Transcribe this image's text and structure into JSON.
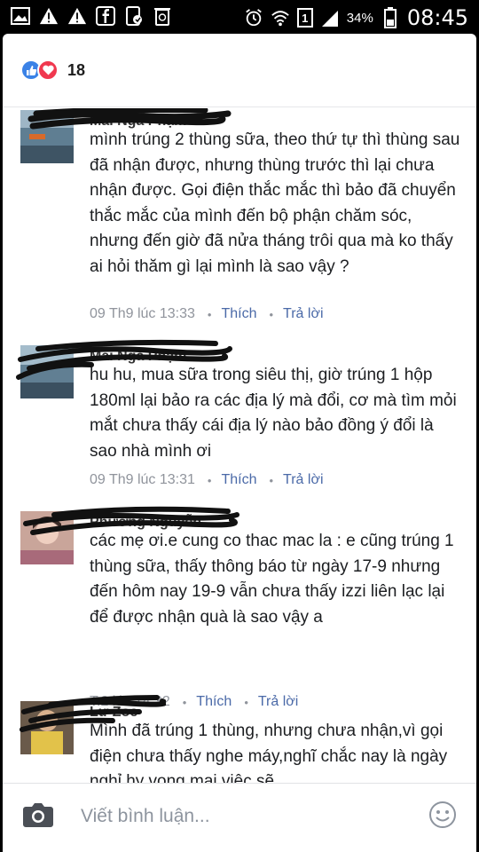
{
  "status_bar": {
    "battery_percent": "34%",
    "time": "08:45",
    "sim_slot": "1",
    "left_icons": [
      "gallery-icon",
      "warning-icon",
      "warning-icon",
      "facebook-icon",
      "phone-icon",
      "recycle-icon"
    ],
    "right_icons": [
      "alarm-icon",
      "wifi-icon",
      "sim-icon",
      "signal-icon",
      "battery-icon"
    ]
  },
  "reactions": {
    "count": "18",
    "types": [
      "like-icon",
      "love-icon"
    ]
  },
  "comments": [
    {
      "author": "Mai Nga Phạm",
      "text": "mình trúng 2 thùng sữa, theo thứ tự thì thùng sau đã nhận được, nhưng thùng trước thì lại chưa nhận được. Gọi điện thắc mắc thì bảo đã chuyển thắc mắc của mình đến bộ phận chăm sóc, nhưng đến giờ đã nửa tháng trôi qua mà ko thấy ai hỏi thăm gì lại mình là sao vậy ?",
      "time": "09 Th9 lúc 13:33",
      "like_label": "Thích",
      "reply_label": "Trả lời"
    },
    {
      "author": "Mai Nga Phạm",
      "text": "hu hu, mua sữa trong siêu thị, giờ trúng 1 hộp 180ml lại bảo ra các địa lý mà đổi, cơ mà tìm mỏi mắt chưa thấy cái địa lý nào bảo đồng ý đổi là sao nhà mình ơi",
      "time": "09 Th9 lúc 13:31",
      "like_label": "Thích",
      "reply_label": "Trả lời"
    },
    {
      "author": "Phương Nguyễn",
      "text": "các mẹ ơi.e cung co thac mac la : e cũng trúng 1 thùng sữa, thấy thông báo từ ngày 17-9 nhưng đến hôm nay 19-9 vẫn chưa thấy izzi liên lạc lại để được nhận quà là sao vậy a",
      "time": "T.2 lúc 14:32",
      "like_label": "Thích",
      "reply_label": "Trả lời"
    },
    {
      "author": "Lư Zoe",
      "text": "Mình đã trúng 1 thùng, nhưng chưa nhận,vì gọi điện chưa thấy nghe máy,nghĩ chắc nay là ngày nghỉ hy vọng mai việc sẽ",
      "time": "",
      "like_label": "",
      "reply_label": ""
    }
  ],
  "composer": {
    "placeholder": "Viết bình luận...",
    "camera_icon": "camera-icon",
    "emoji_icon": "smiley-icon"
  },
  "colors": {
    "link": "#4b6aa8",
    "meta": "#90949c",
    "like_blue": "#3b82e6",
    "love_red": "#f0384f"
  }
}
